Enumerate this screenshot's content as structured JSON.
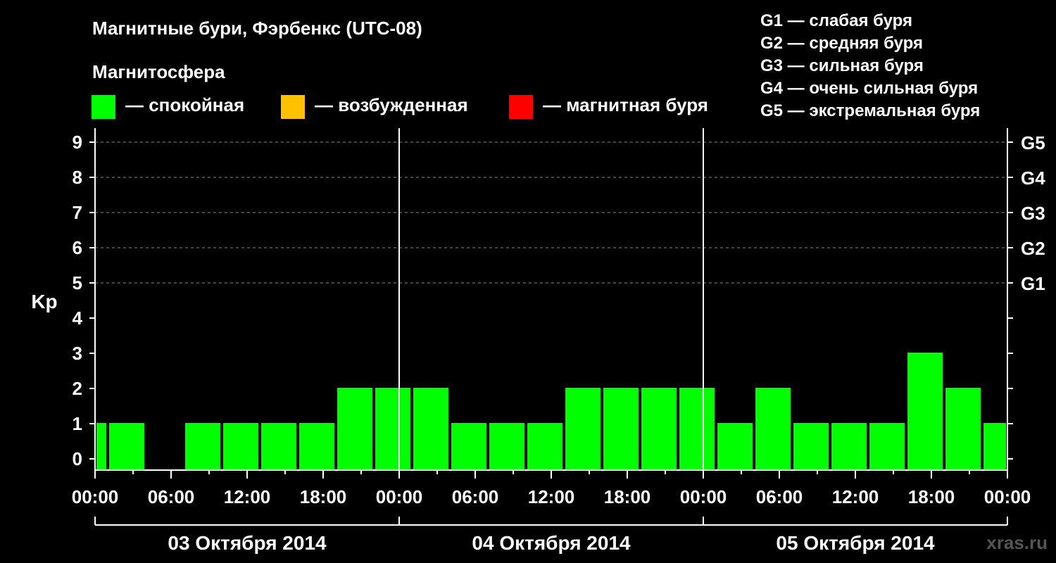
{
  "title": "Магнитные бури, Фэрбенкс (UTC-08)",
  "subtitle": "Магнитосфера",
  "legend": [
    {
      "label": "— спокойная",
      "color": "#00ff00"
    },
    {
      "label": "— возбужденная",
      "color": "#ffc000"
    },
    {
      "label": "— магнитная буря",
      "color": "#ff0000"
    }
  ],
  "g_scale": [
    "G1 — слабая буря",
    "G2 — средняя буря",
    "G3 — сильная буря",
    "G4 — очень сильная буря",
    "G5 — экстремальная буря"
  ],
  "watermark": "xras.ru",
  "chart_data": {
    "type": "bar",
    "ylabel": "Kp",
    "ylim": [
      0,
      9
    ],
    "yticks": [
      0,
      1,
      2,
      3,
      4,
      5,
      6,
      7,
      8,
      9
    ],
    "right_axis_labels": [
      {
        "kp": 5,
        "label": "G1"
      },
      {
        "kp": 6,
        "label": "G2"
      },
      {
        "kp": 7,
        "label": "G3"
      },
      {
        "kp": 8,
        "label": "G4"
      },
      {
        "kp": 9,
        "label": "G5"
      }
    ],
    "grid": "horizontal dashed at Kp 5–9",
    "xticks": [
      "00:00",
      "06:00",
      "12:00",
      "18:00",
      "00:00",
      "06:00",
      "12:00",
      "18:00",
      "00:00",
      "06:00",
      "12:00",
      "18:00",
      "00:00"
    ],
    "days": [
      "03 Октября 2014",
      "04 Октября 2014",
      "05 Октября 2014"
    ],
    "x_range_hours": [
      0,
      72
    ],
    "bar_start_hours": [
      -2,
      1,
      4,
      7,
      10,
      13,
      16,
      19,
      22,
      25,
      28,
      31,
      34,
      37,
      40,
      43,
      46,
      49,
      52,
      55,
      58,
      61,
      64,
      67,
      70
    ],
    "bar_width_hours": 3,
    "values": [
      1,
      1,
      0,
      1,
      1,
      1,
      1,
      2,
      2,
      2,
      1,
      1,
      1,
      2,
      2,
      2,
      2,
      1,
      2,
      1,
      1,
      1,
      3,
      2,
      1
    ],
    "bar_color": "#00ff00"
  }
}
